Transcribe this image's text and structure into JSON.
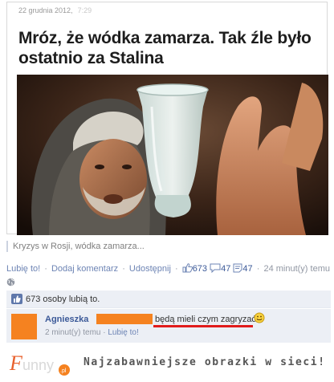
{
  "article": {
    "date": "22 grudnia 2012,",
    "time": "7:29",
    "headline": "Mróz, że wódka zamarza. Tak źle było ostatnio za Stalina"
  },
  "caption": "Kryzys w Rosji, wódka zamarza...",
  "actions": {
    "like": "Lubię to!",
    "comment": "Dodaj komentarz",
    "share": "Udostępnij",
    "likes_count": "673",
    "shares_count": "47",
    "comments_count": "47",
    "time_ago": "24 minut(y) temu"
  },
  "likes_summary": "673 osoby lubią to.",
  "comment": {
    "author": "Agnieszka",
    "text": "będą mieli czym zagryzać",
    "time_ago": "2 minut(y) temu",
    "like": "Lubię to!"
  },
  "footer": {
    "logo_text": "Funny",
    "logo_suffix": ".pl",
    "tagline": "Najzabawniejsze obrazki w sieci!"
  },
  "colors": {
    "accent": "#3b5998",
    "link": "#6d84b4",
    "redaction": "#f58220",
    "underline": "#e11b1b"
  }
}
